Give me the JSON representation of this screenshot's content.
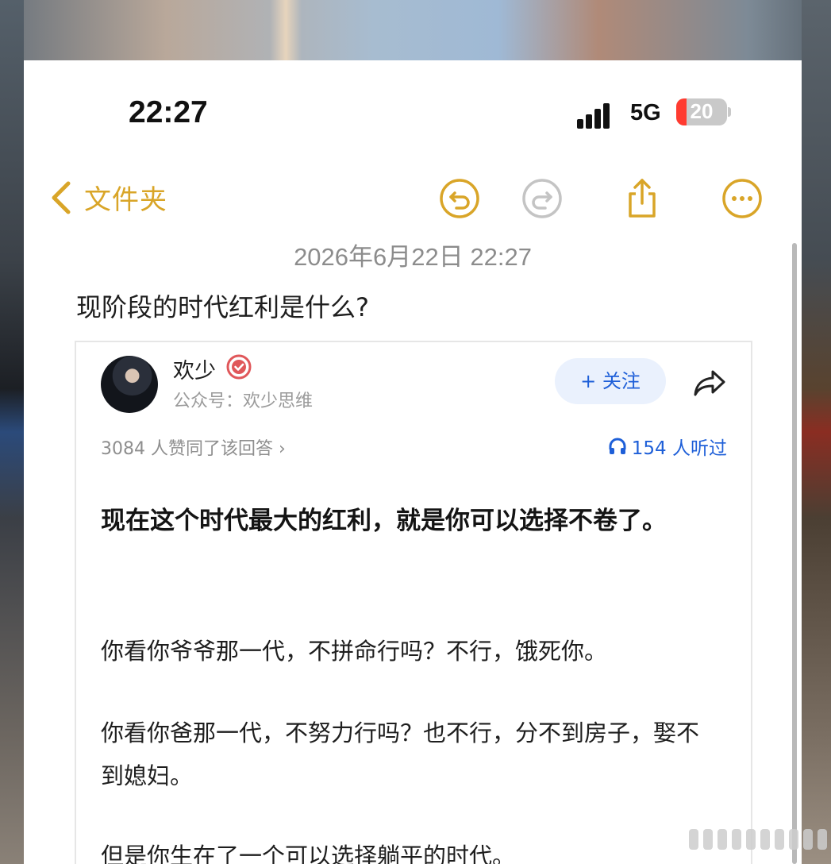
{
  "status_bar": {
    "time": "22:27",
    "network": "5G",
    "battery": "20",
    "battery_level": 0.2
  },
  "nav": {
    "back_label": "文件夹",
    "icons": [
      "undo-icon",
      "redo-icon",
      "share-icon",
      "more-icon"
    ]
  },
  "note": {
    "date": "2026年6月22日 22:27",
    "title": "现阶段的时代红利是什么?"
  },
  "answer": {
    "author": "欢少",
    "account": "公众号：欢少思维",
    "follow_label": "+ 关注",
    "agree_text": "3084 人赞同了该回答 ›",
    "listen_text": "154 人听过",
    "headline": "现在这个时代最大的红利，就是你可以选择不卷了。",
    "paragraphs": [
      "你看你爷爷那一代，不拼命行吗？不行，饿死你。",
      "你看你爸那一代，不努力行吗？也不行，分不到房子，娶不到媳妇。",
      "但是你生在了一个可以选择躺平的时代。"
    ]
  },
  "colors": {
    "accent_yellow": "#d9a528",
    "link_blue": "#1e5fd8",
    "battery_red": "#ff3b30"
  }
}
